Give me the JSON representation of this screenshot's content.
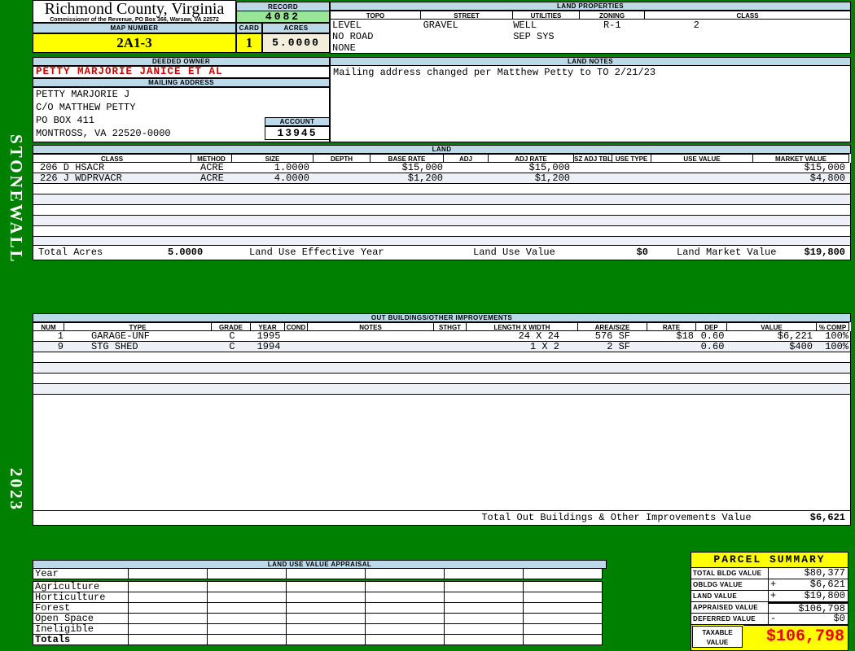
{
  "sidebar": {
    "district": "STONEWALL",
    "year": "2023"
  },
  "county": {
    "title": "Richmond County, Virginia",
    "subtitle": "Commissioner of the Revenue, PO Box 366, Warsaw, VA 22572"
  },
  "record": {
    "label": "RECORD",
    "value": "4082"
  },
  "map_number": {
    "label": "MAP NUMBER",
    "value": "2A1-3"
  },
  "card": {
    "label": "CARD",
    "value": "1"
  },
  "acres": {
    "label": "ACRES",
    "value": "5.0000"
  },
  "land_properties": {
    "title": "LAND PROPERTIES",
    "columns": [
      "TOPO",
      "STREET",
      "UTILITIES",
      "ZONING",
      "CLASS"
    ],
    "topo_lines": [
      "LEVEL",
      "NO ROAD",
      "NONE"
    ],
    "street": "GRAVEL",
    "utilities_lines": [
      "WELL",
      "SEP SYS"
    ],
    "zoning": "R-1",
    "class": "2"
  },
  "deeded_owner": {
    "label": "DEEDED OWNER",
    "value": "PETTY MARJORIE JANICE ET AL"
  },
  "mailing_address": {
    "label": "MAILING ADDRESS",
    "lines": [
      "PETTY MARJORIE J",
      "C/O MATTHEW PETTY",
      "PO BOX 411",
      "MONTROSS, VA 22520-0000"
    ]
  },
  "account": {
    "label": "ACCOUNT",
    "value": "13945"
  },
  "land_notes": {
    "title": "LAND NOTES",
    "note": "Mailing address changed per Matthew Petty to TO 2/21/23"
  },
  "land": {
    "title": "LAND",
    "columns": [
      "CLASS",
      "METHOD",
      "SIZE",
      "DEPTH",
      "BASE RATE",
      "ADJ",
      "ADJ RATE",
      "SZ ADJ TBL",
      "USE TYPE",
      "USE VALUE",
      "MARKET VALUE"
    ],
    "rows": [
      {
        "class": "206 D HSACR",
        "method": "ACRE",
        "size": "1.0000",
        "depth": "",
        "base_rate": "$15,000",
        "adj": "",
        "adj_rate": "$15,000",
        "sz_adj_tbl": "",
        "use_type": "",
        "use_value": "",
        "market_value": "$15,000"
      },
      {
        "class": "226 J WDPRVACR",
        "method": "ACRE",
        "size": "4.0000",
        "depth": "",
        "base_rate": "$1,200",
        "adj": "",
        "adj_rate": "$1,200",
        "sz_adj_tbl": "",
        "use_type": "",
        "use_value": "",
        "market_value": "$4,800"
      }
    ],
    "totals": {
      "total_acres_label": "Total Acres",
      "total_acres": "5.0000",
      "effective_year_label": "Land Use Effective Year",
      "use_value_label": "Land Use Value",
      "use_value": "$0",
      "market_value_label": "Land Market Value",
      "market_value": "$19,800"
    }
  },
  "out_buildings": {
    "title": "OUT BUILDINGS/OTHER IMPROVEMENTS",
    "columns": [
      "NUM",
      "TYPE",
      "GRADE",
      "YEAR",
      "COND",
      "NOTES",
      "STHGT",
      "LENGTH X WIDTH",
      "AREA/SIZE",
      "RATE",
      "DEP",
      "VALUE",
      "% COMP"
    ],
    "rows": [
      {
        "num": "1",
        "type": "GARAGE-UNF",
        "grade": "C",
        "year": "1995",
        "cond": "",
        "notes": "",
        "sthgt": "",
        "length_x_width": "24 X 24",
        "area_size": "576 SF",
        "rate": "$18",
        "dep": "0.60",
        "value": "$6,221",
        "comp": "100%"
      },
      {
        "num": "9",
        "type": "STG SHED",
        "grade": "C",
        "year": "1994",
        "cond": "",
        "notes": "",
        "sthgt": "",
        "length_x_width": "1 X 2",
        "area_size": "2 SF",
        "rate": "",
        "dep": "0.60",
        "value": "$400",
        "comp": "100%"
      }
    ],
    "total_label": "Total Out Buildings & Other Improvements Value",
    "total_value": "$6,621"
  },
  "land_use_appraisal": {
    "title": "LAND USE VALUE APPRAISAL",
    "row_labels": [
      "Year",
      "Agriculture",
      "Horticulture",
      "Forest",
      "Open Space",
      "Ineligible",
      "Totals"
    ]
  },
  "parcel_summary": {
    "title": "PARCEL SUMMARY",
    "rows": [
      {
        "label": "TOTAL BLDG VALUE",
        "op": "",
        "value": "$80,377"
      },
      {
        "label": "OBLDG VALUE",
        "op": "+",
        "value": "$6,621"
      },
      {
        "label": "LAND VALUE",
        "op": "+",
        "value": "$19,800"
      },
      {
        "label": "APPRAISED VALUE",
        "op": "",
        "value": "$106,798"
      },
      {
        "label": "DEFERRED VALUE",
        "op": "-",
        "value": "$0"
      }
    ],
    "taxable": {
      "label_line1": "TAXABLE",
      "label_line2": "VALUE",
      "value": "$106,798"
    }
  },
  "colors": {
    "background_green": "#008000",
    "header_blue": "#bcd9ea",
    "record_green": "#99e699",
    "highlight_yellow": "#ffff00",
    "acres_cream": "#f2eedb",
    "owner_red": "#cc0000",
    "taxable_red": "#ee0000",
    "row_stripe": "#eef0f8"
  }
}
